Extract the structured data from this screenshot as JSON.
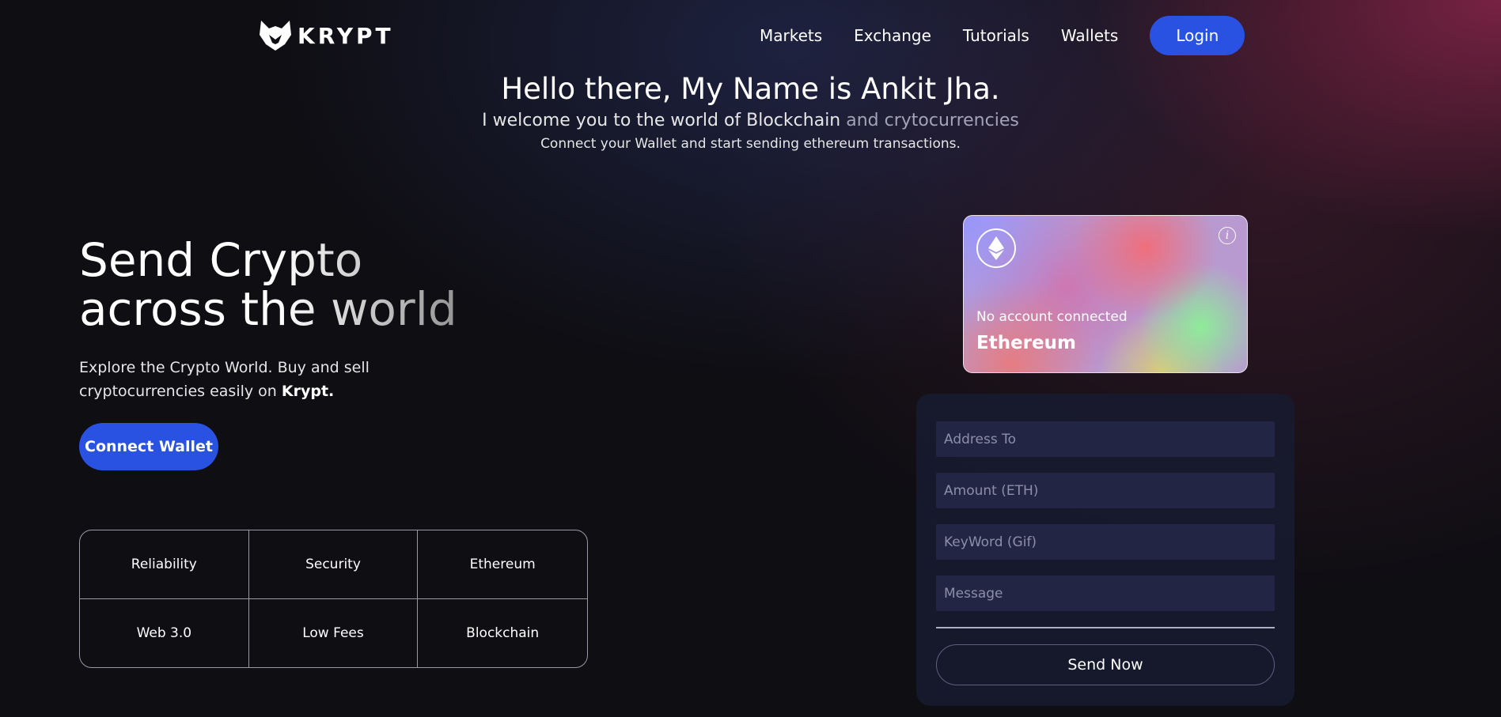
{
  "brand": {
    "name": "KRYPT"
  },
  "nav": {
    "links": [
      "Markets",
      "Exchange",
      "Tutorials",
      "Wallets"
    ],
    "login_label": "Login"
  },
  "intro": {
    "title": "Hello there, My Name is Ankit Jha.",
    "subtitle_main": "I welcome you to the world of Blockchain",
    "subtitle_fade": " and crytocurrencies",
    "tagline": "Connect your Wallet and start sending ethereum transactions."
  },
  "hero": {
    "title_line1": "Send Crypto",
    "title_line2": "across the world",
    "desc_text": "Explore the Crypto World. Buy and sell cryptocurrencies easily on ",
    "desc_bold": "Krypt.",
    "connect_label": "Connect Wallet"
  },
  "features": [
    "Reliability",
    "Security",
    "Ethereum",
    "Web 3.0",
    "Low Fees",
    "Blockchain"
  ],
  "card": {
    "account_status": "No account connected",
    "network": "Ethereum",
    "info_glyph": "i"
  },
  "form": {
    "address_placeholder": "Address To",
    "amount_placeholder": "Amount (ETH)",
    "keyword_placeholder": "KeyWord (Gif)",
    "message_placeholder": "Message",
    "send_label": "Send Now"
  },
  "colors": {
    "accent": "#2952e3",
    "background": "#0f0e13",
    "form_bg": "#181b30",
    "field_bg": "#222544"
  },
  "icons": [
    "krypt-logo-icon",
    "ethereum-icon",
    "info-icon"
  ]
}
